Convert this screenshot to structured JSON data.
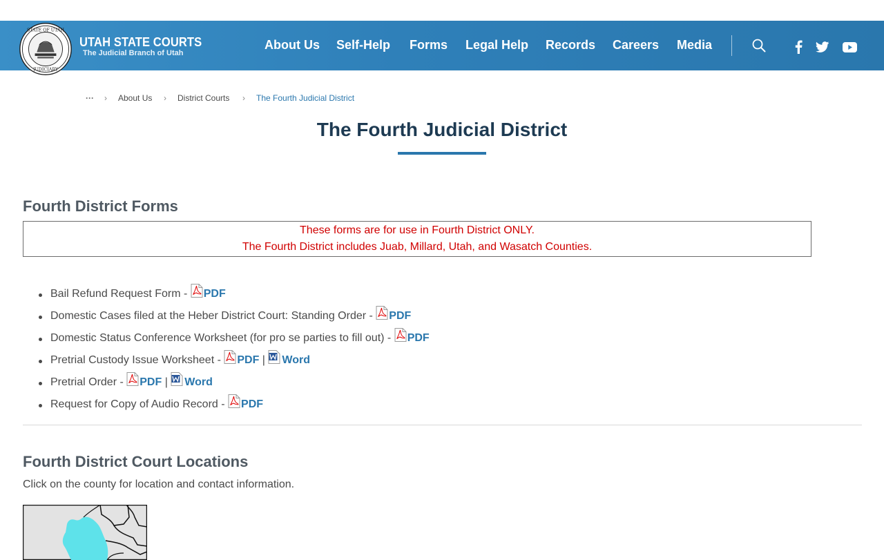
{
  "brand": {
    "title": "UTAH STATE COURTS",
    "subtitle": "The Judicial Branch of Utah",
    "seal_label": "State of Utah Judiciary seal",
    "seal_top_text": "STATE OF UTAH",
    "seal_bottom_text": "JUDICIARY"
  },
  "nav": {
    "items": [
      "About Us",
      "Self-Help",
      "Forms",
      "Legal Help",
      "Records",
      "Careers",
      "Media"
    ]
  },
  "header_icons": [
    "search-icon",
    "facebook-icon",
    "twitter-icon",
    "youtube-icon"
  ],
  "breadcrumb": {
    "ellipsis": "···",
    "items": [
      "About Us",
      "District Courts",
      "The Fourth Judicial District"
    ],
    "separator": "›"
  },
  "page": {
    "title": "The Fourth Judicial District"
  },
  "forms_section": {
    "heading": "Fourth District Forms",
    "notice_line1": "These forms are for use in Fourth District ONLY.",
    "notice_line2": "The Fourth District includes Juab, Millard, Utah, and Wasatch Counties.",
    "items": [
      {
        "label": "Bail Refund Request Form - ",
        "pdf": "PDF"
      },
      {
        "label": "Domestic Cases filed at the Heber District Court: Standing Order - ",
        "pdf": "PDF"
      },
      {
        "label": "Domestic Status Conference Worksheet (for pro se parties to fill out) - ",
        "pdf": "PDF"
      },
      {
        "label": "Pretrial Custody Issue Worksheet - ",
        "pdf": "PDF",
        "sep": " | ",
        "word": "Word"
      },
      {
        "label": "Pretrial Order - ",
        "pdf": "PDF",
        "sep": " | ",
        "word": "Word"
      },
      {
        "label": "Request for Copy of Audio Record - ",
        "pdf": "PDF"
      }
    ]
  },
  "locations_section": {
    "heading": "Fourth District Court Locations",
    "instruction": "Click on the county for location and contact information."
  },
  "colors": {
    "header_blue": "#2f80b9",
    "link_blue": "#2a77ad",
    "title_navy": "#1d3a52",
    "notice_red": "#d00000",
    "map_highlight": "#5ee2ea"
  }
}
